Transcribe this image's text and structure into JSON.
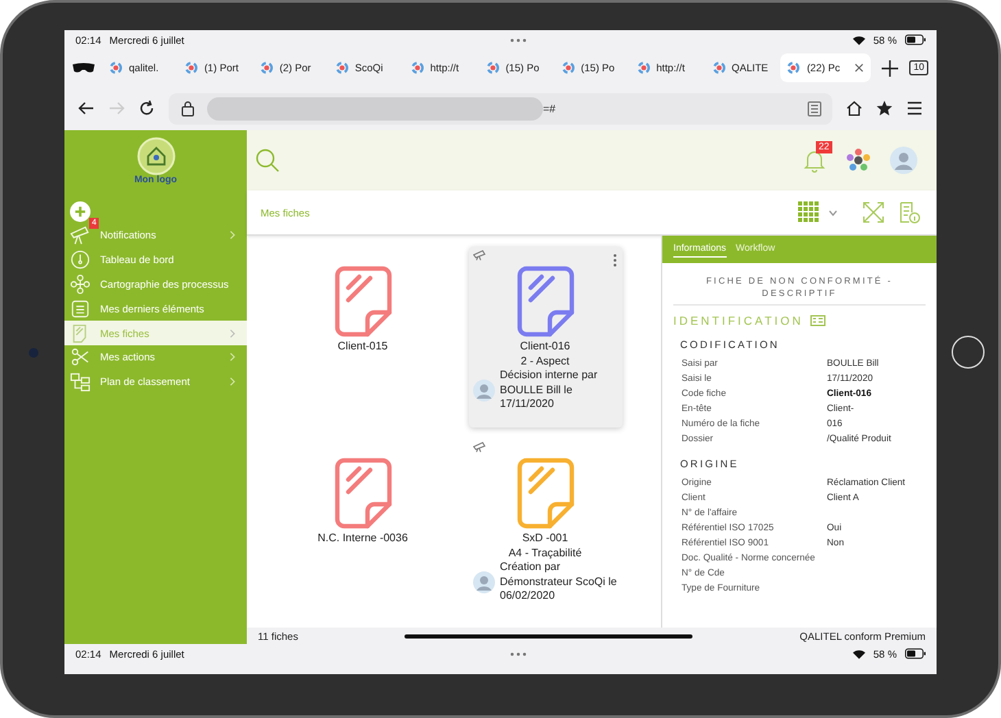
{
  "status_bar": {
    "time": "02:14",
    "date": "Mercredi 6 juillet",
    "battery": "58 %"
  },
  "browser_tabs": [
    {
      "label": "qalitel.",
      "selected": false
    },
    {
      "label": "(1) Port",
      "selected": false
    },
    {
      "label": "(2) Por",
      "selected": false
    },
    {
      "label": "ScoQi",
      "selected": false
    },
    {
      "label": "http://t",
      "selected": false
    },
    {
      "label": "(15) Po",
      "selected": false
    },
    {
      "label": "(15) Po",
      "selected": false
    },
    {
      "label": "http://t",
      "selected": false
    },
    {
      "label": "QALITE",
      "selected": false
    },
    {
      "label": "(22) Pc",
      "selected": true
    }
  ],
  "tab_count": "10",
  "address_bar": {
    "value_suffix": "=#"
  },
  "sidebar": {
    "logo_text": "Mon logo",
    "items": [
      {
        "kind": "notifications",
        "label": "Notifications",
        "has_submenu": true,
        "badge": "4",
        "selected": false
      },
      {
        "kind": "dashboard",
        "label": "Tableau de bord",
        "has_submenu": false,
        "selected": false
      },
      {
        "kind": "map",
        "label": "Cartographie des processus",
        "has_submenu": false,
        "selected": false
      },
      {
        "kind": "recent",
        "label": "Mes derniers éléments",
        "has_submenu": false,
        "selected": false
      },
      {
        "kind": "sheets",
        "label": "Mes fiches",
        "has_submenu": true,
        "selected": true
      },
      {
        "kind": "actions",
        "label": "Mes actions",
        "has_submenu": true,
        "selected": false
      },
      {
        "kind": "classification",
        "label": "Plan de classement",
        "has_submenu": true,
        "selected": false
      }
    ]
  },
  "header": {
    "notification_count": "22"
  },
  "breadcrumb": "Mes fiches",
  "cards": [
    {
      "title": "Client-015",
      "color": "#f47c7c",
      "selected": false,
      "tagged": false
    },
    {
      "title": "Client-016",
      "subtitle": "2 - Aspect",
      "history": "Décision interne par BOULLE Bill le 17/11/2020",
      "color": "#7b7cf0",
      "selected": true,
      "tagged": true
    },
    {
      "title": "N.C. Interne -0036",
      "color": "#f47c7c",
      "selected": false,
      "tagged": false
    },
    {
      "title": "SxD -001",
      "subtitle": "A4 - Traçabilité",
      "history": "Création par Démonstrateur ScoQi le 06/02/2020",
      "color": "#f8b030",
      "selected": false,
      "tagged": true
    }
  ],
  "detail_panel": {
    "tabs": [
      {
        "label": "Informations",
        "selected": true
      },
      {
        "label": "Workflow",
        "selected": false
      }
    ],
    "title": "FICHE DE NON CONFORMITÉ - DESCRIPTIF",
    "section": "IDENTIFICATION",
    "groups": [
      {
        "name": "CODIFICATION",
        "rows": [
          {
            "label": "Saisi par",
            "value": "BOULLE Bill"
          },
          {
            "label": "Saisi le",
            "value": "17/11/2020"
          },
          {
            "label": "Code fiche",
            "value": "Client-016",
            "emphasis": true
          },
          {
            "label": "En-tête",
            "value": "Client-"
          },
          {
            "label": "Numéro de la fiche",
            "value": "016"
          },
          {
            "label": "Dossier",
            "value": "/Qualité Produit"
          }
        ]
      },
      {
        "name": "ORIGINE",
        "rows": [
          {
            "label": "Origine",
            "value": "Réclamation Client"
          },
          {
            "label": "Client",
            "value": "Client A"
          },
          {
            "label": "N° de l'affaire"
          },
          {
            "label": "Référentiel ISO 17025",
            "value": "Oui"
          },
          {
            "label": "Référentiel ISO 9001",
            "value": "Non"
          },
          {
            "label": "Doc. Qualité - Norme concernée"
          },
          {
            "label": "N° de Cde"
          },
          {
            "label": "Type de Fourniture"
          }
        ]
      }
    ]
  },
  "footer": {
    "count": "11 fiches",
    "product": "QALITEL conform Premium"
  },
  "bottom_status_bar": {
    "time": "02:14",
    "date": "Mercredi 6 juillet",
    "battery": "58 %"
  }
}
